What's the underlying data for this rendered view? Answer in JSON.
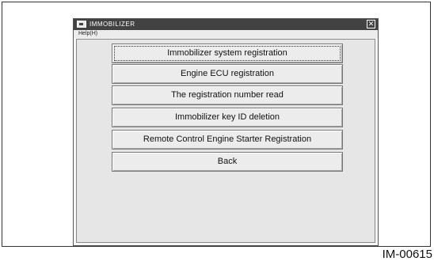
{
  "window": {
    "title": "IMMOBILIZER",
    "close_glyph": "✕"
  },
  "menu": {
    "help_label": "Help(H)"
  },
  "buttons": [
    {
      "label": "Immobilizer system registration",
      "focused": true
    },
    {
      "label": "Engine ECU registration"
    },
    {
      "label": "The registration number read"
    },
    {
      "label": "Immobilizer key ID deletion"
    },
    {
      "label": "Remote Control Engine Starter Registration"
    },
    {
      "label": "Back"
    }
  ],
  "figure_id": "IM-00615"
}
